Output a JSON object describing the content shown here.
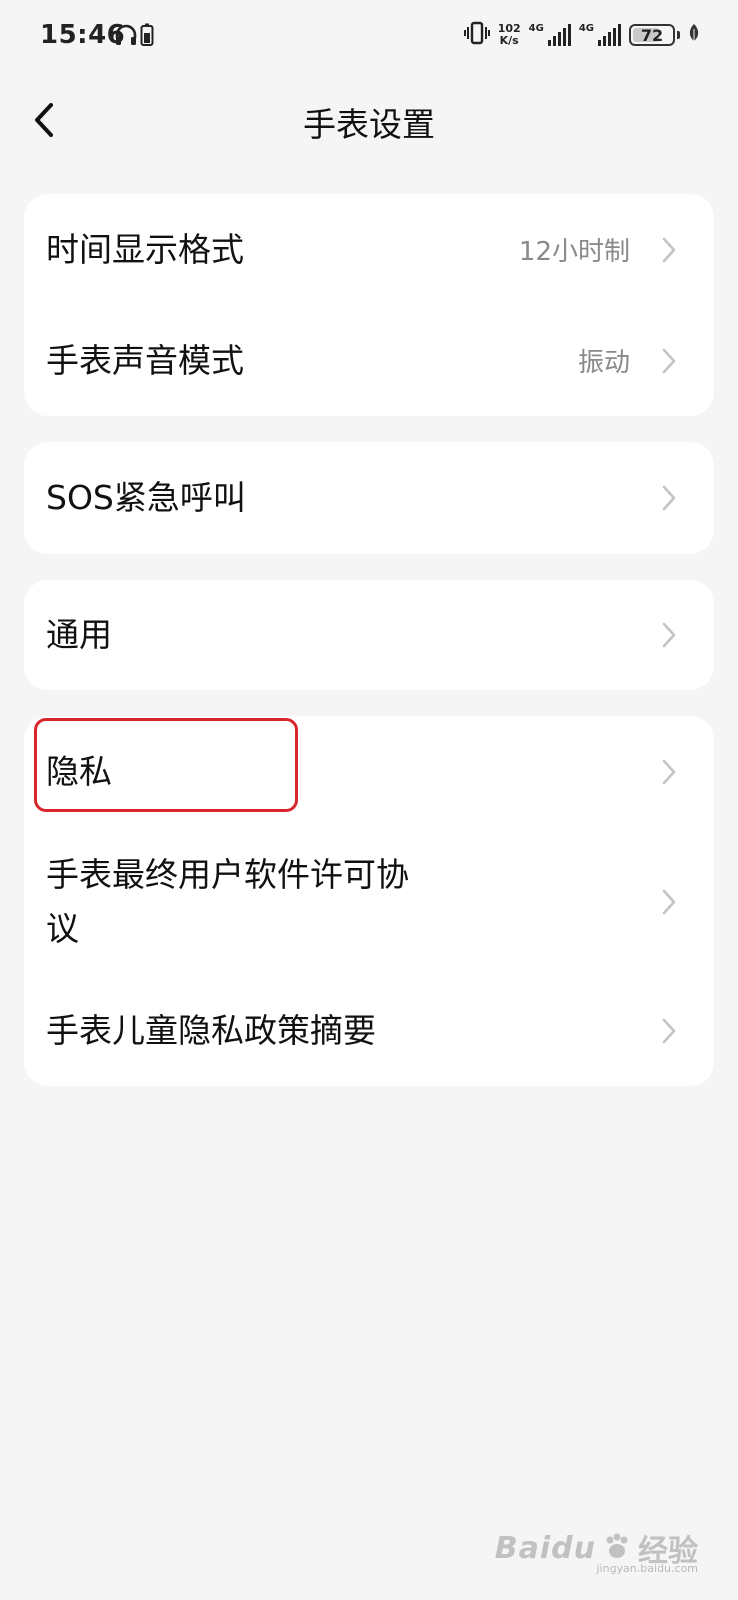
{
  "status_bar": {
    "time": "15:46",
    "net_speed_value": "102",
    "net_speed_unit": "K/s",
    "sim1_label": "4G",
    "sim2_label": "4G",
    "battery_level": "72",
    "battery_fraction": 0.72,
    "icons": [
      "headphones-icon",
      "phone-battery-icon",
      "vibrate-icon",
      "signal-icon",
      "leaf-icon"
    ]
  },
  "header": {
    "title": "手表设置",
    "back_icon": "chevron-left-icon"
  },
  "groups": [
    {
      "items": [
        {
          "label": "时间显示格式",
          "value": "12小时制"
        },
        {
          "label": "手表声音模式",
          "value": "振动"
        }
      ]
    },
    {
      "items": [
        {
          "label": "SOS紧急呼叫",
          "value": ""
        }
      ]
    },
    {
      "items": [
        {
          "label": "通用",
          "value": ""
        }
      ]
    },
    {
      "items": [
        {
          "label": "隐私",
          "value": ""
        },
        {
          "label_line1": "手表最终用户软件许可协",
          "label_line2": "议",
          "value": ""
        },
        {
          "label": "手表儿童隐私政策摘要",
          "value": ""
        }
      ]
    }
  ],
  "annotation": {
    "highlight_color": "#d9262c"
  },
  "watermark": {
    "brand": "Baidu",
    "cn": "经验",
    "sub": "jingyan.baidu.com"
  }
}
